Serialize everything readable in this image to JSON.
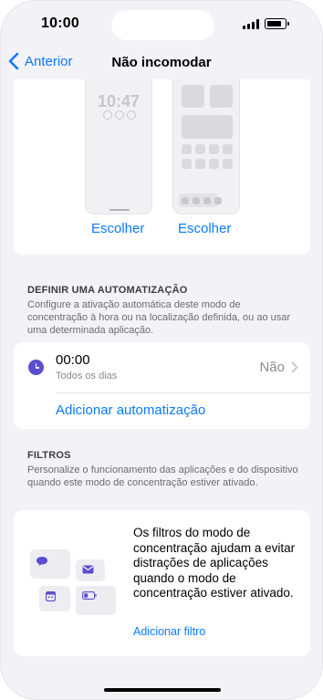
{
  "status_bar": {
    "time": "10:00",
    "battery_level": 0.85
  },
  "nav": {
    "back_label": "Anterior",
    "title": "Não incomodar"
  },
  "preview": {
    "lock_screen_time": "10:47",
    "choose_lock_label": "Escolher",
    "choose_home_label": "Escolher"
  },
  "automation": {
    "section_title": "DEFINIR UMA AUTOMATIZAÇÃO",
    "section_desc": "Configure a ativação automática deste modo de concentração à hora ou na localização definida, ou ao usar uma determinada aplicação.",
    "item_time": "00:00",
    "item_days": "Todos os dias",
    "item_value": "Não",
    "add_label": "Adicionar automatização"
  },
  "filters": {
    "section_title": "FILTROS",
    "section_desc": "Personalize o funcionamento das aplicações e do dispositivo quando este modo de concentração estiver ativado.",
    "card_text": "Os filtros do modo de concentração ajudam a evitar distrações de aplicações quando o modo de concentração estiver ativado.",
    "add_label": "Adicionar filtro"
  },
  "colors": {
    "accent": "#0a7aff",
    "automation_icon": "#5b4fcf",
    "background": "#f2f2f7"
  },
  "icons": [
    "signal-icon",
    "battery-icon",
    "chevron-left-icon",
    "clock-icon",
    "chevron-right-icon",
    "message-icon",
    "mail-icon",
    "calendar-icon",
    "battery-widget-icon"
  ]
}
